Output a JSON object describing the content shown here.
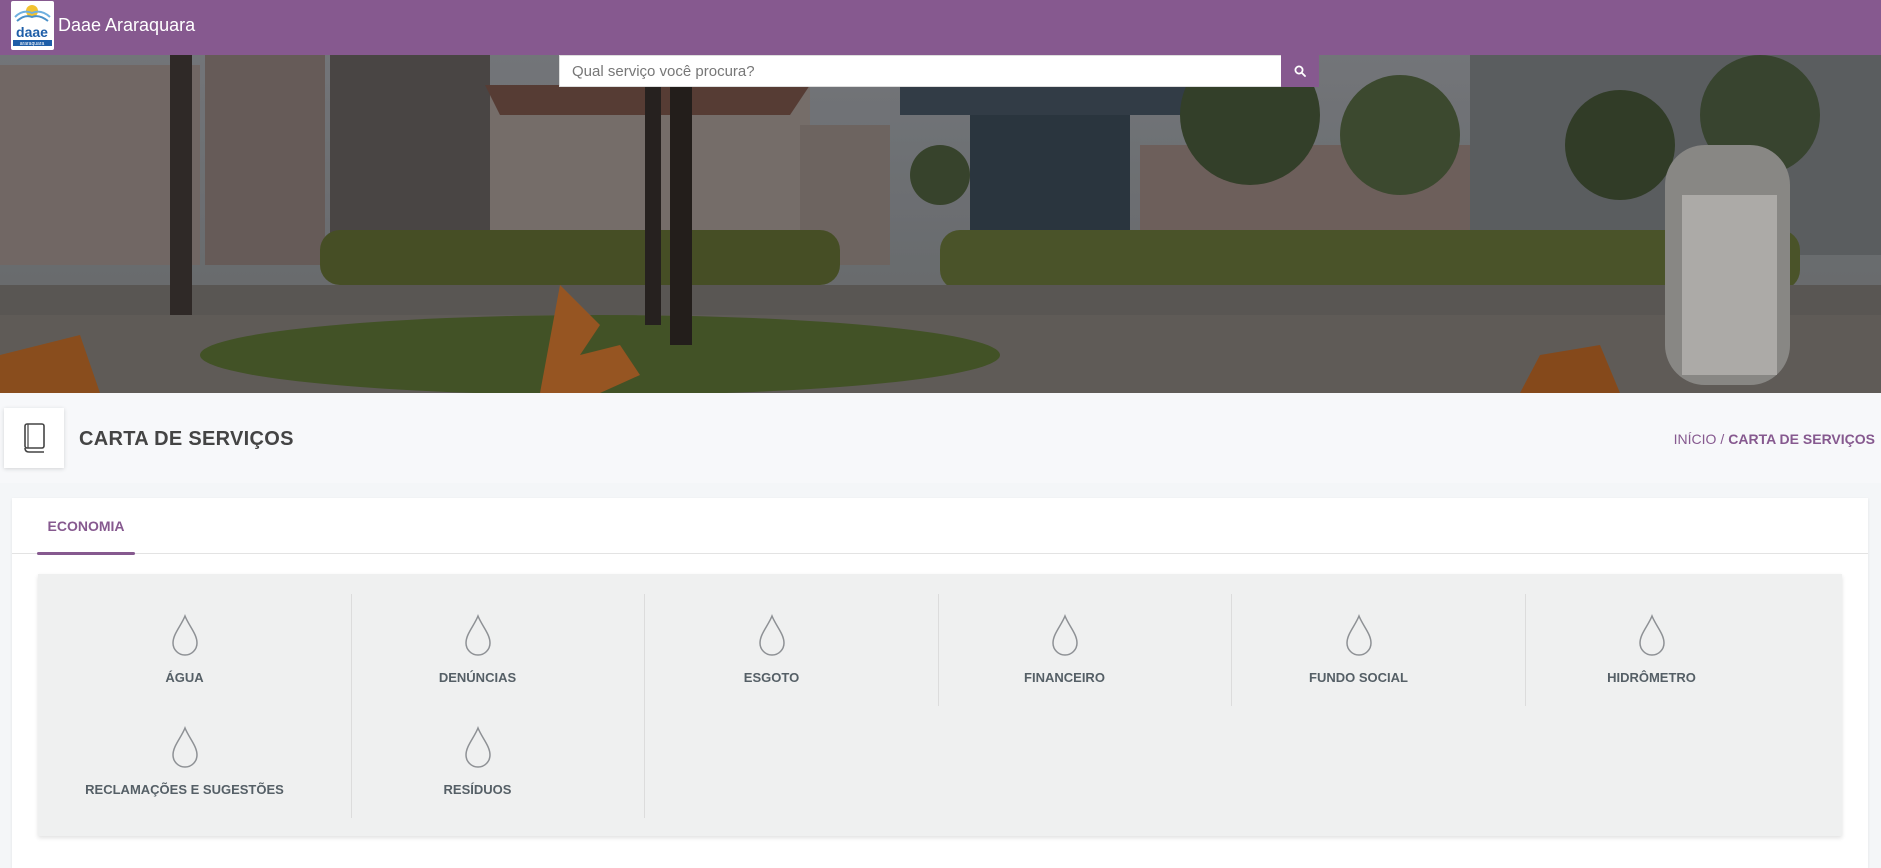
{
  "header": {
    "brand": "Daae Araraquara",
    "logo_text": "daae",
    "logo_subtext": "araraquara",
    "color": "#86598f"
  },
  "search": {
    "placeholder": "Qual serviço você procura?",
    "button_icon": "search-icon"
  },
  "page": {
    "title": "CARTA DE SERVIÇOS",
    "title_icon": "book-icon"
  },
  "breadcrumb": {
    "home": "INÍCIO",
    "separator": "/",
    "current": "CARTA DE SERVIÇOS"
  },
  "tabs": [
    {
      "label": "ECONOMIA",
      "active": true
    }
  ],
  "categories": [
    {
      "label": "ÁGUA",
      "icon": "water-drop-icon"
    },
    {
      "label": "DENÚNCIAS",
      "icon": "water-drop-icon"
    },
    {
      "label": "ESGOTO",
      "icon": "water-drop-icon"
    },
    {
      "label": "FINANCEIRO",
      "icon": "water-drop-icon"
    },
    {
      "label": "FUNDO SOCIAL",
      "icon": "water-drop-icon"
    },
    {
      "label": "HIDRÔMETRO",
      "icon": "water-drop-icon"
    },
    {
      "label": "RECLAMAÇÕES E SUGESTÕES",
      "icon": "water-drop-icon"
    },
    {
      "label": "RESÍDUOS",
      "icon": "water-drop-icon"
    }
  ]
}
